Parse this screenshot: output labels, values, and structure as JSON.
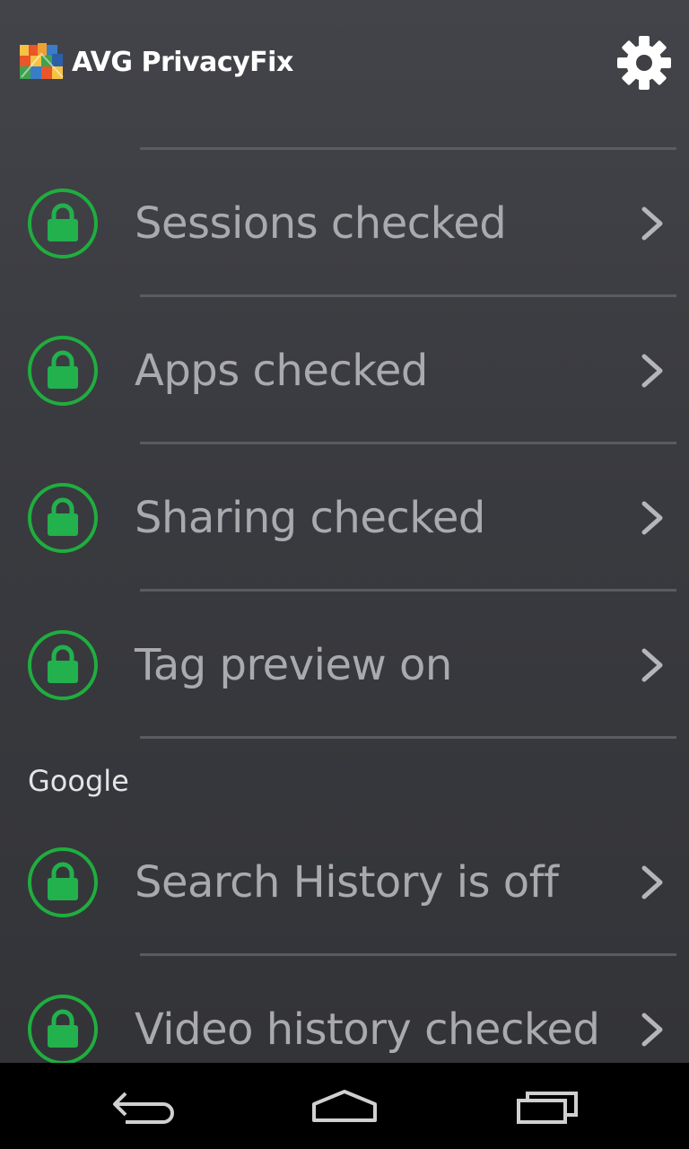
{
  "header": {
    "brand_text": "AVG PrivacyFix",
    "logo_icon": "avg-logo-icon",
    "settings_icon": "gear-icon"
  },
  "items": [
    {
      "label": "Sessions checked",
      "status": "checked",
      "icon": "lock-icon"
    },
    {
      "label": "Apps checked",
      "status": "checked",
      "icon": "lock-icon"
    },
    {
      "label": "Sharing checked",
      "status": "checked",
      "icon": "lock-icon"
    },
    {
      "label": "Tag preview on",
      "status": "checked",
      "icon": "lock-icon"
    }
  ],
  "section": {
    "title": "Google",
    "items": [
      {
        "label": "Search History is off",
        "status": "checked",
        "icon": "lock-icon"
      },
      {
        "label": "Video history checked",
        "status": "checked",
        "icon": "lock-icon"
      }
    ]
  },
  "colors": {
    "accent_green": "#22b14c",
    "ring_green": "#1fae3e",
    "label_gray": "#a9aaad",
    "background": "#3a3b40"
  },
  "navbar": {
    "back_icon": "back-arrow-icon",
    "home_icon": "home-icon",
    "recents_icon": "recent-apps-icon"
  }
}
